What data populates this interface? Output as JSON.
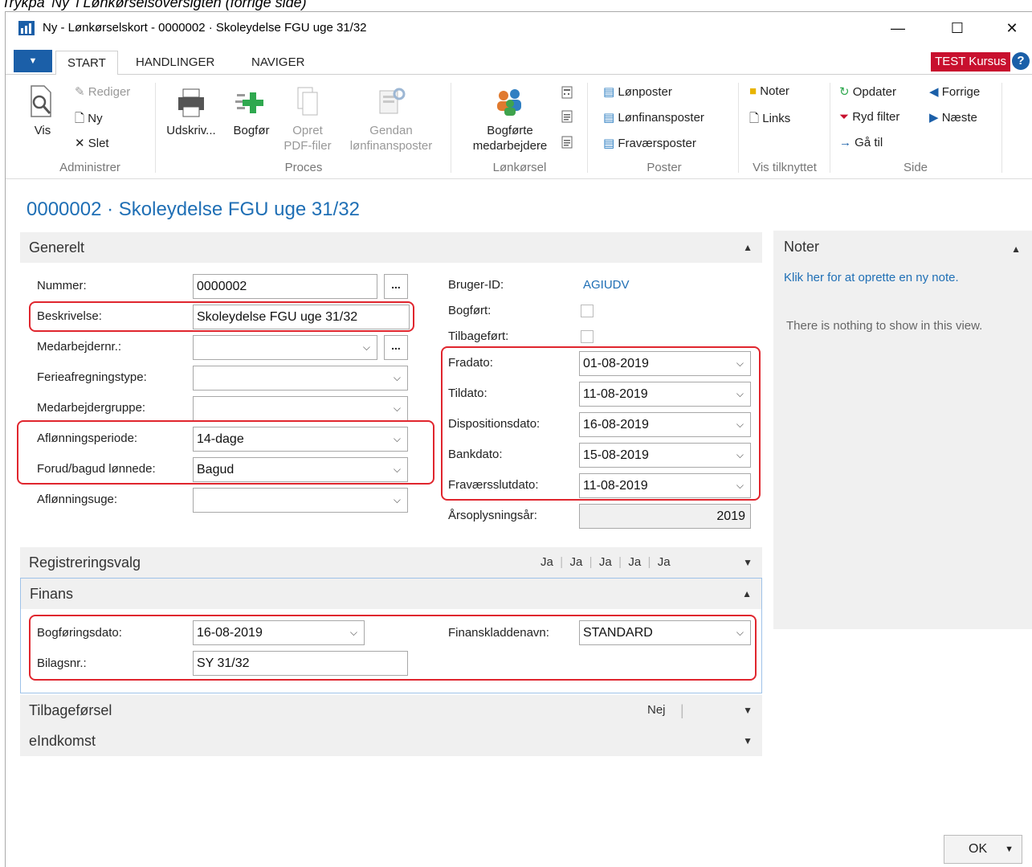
{
  "window": {
    "title": "Ny - Lønkørselskort - 0000002 · Skoleydelse FGU uge 31/32",
    "controls": {
      "minimize": "—",
      "maximize": "☐",
      "close": "✕"
    }
  },
  "tabs": [
    "START",
    "HANDLINGER",
    "NAVIGER"
  ],
  "badge": "TEST Kursus",
  "ribbon": {
    "administrer": {
      "label": "Administrer",
      "vis": "Vis",
      "rediger": "Rediger",
      "ny": "Ny",
      "slet": "Slet"
    },
    "proces": {
      "label": "Proces",
      "udskriv": "Udskriv...",
      "bogfor": "Bogfør",
      "opret_1": "Opret",
      "opret_2": "PDF-filer",
      "gendan_1": "Gendan",
      "gendan_2": "lønfinansposter"
    },
    "lonkorsel": {
      "label": "Lønkørsel",
      "bogforte_1": "Bogførte",
      "bogforte_2": "medarbejdere"
    },
    "poster": {
      "label": "Poster",
      "lonposter": "Lønposter",
      "lonfinansposter": "Lønfinansposter",
      "fravaersposter": "Fraværsposter"
    },
    "vis_tilknyttet": {
      "label": "Vis tilknyttet",
      "noter": "Noter",
      "links": "Links"
    },
    "side": {
      "label": "Side",
      "opdater": "Opdater",
      "ryd_filter": "Ryd filter",
      "ga_til": "Gå til",
      "forrige": "Forrige",
      "naeste": "Næste"
    }
  },
  "page_title": "0000002 · Skoleydelse FGU uge 31/32",
  "generelt": {
    "header": "Generelt",
    "nummer_label": "Nummer:",
    "nummer": "0000002",
    "beskrivelse_label": "Beskrivelse:",
    "beskrivelse": "Skoleydelse FGU uge 31/32",
    "medarbejdernr_label": "Medarbejdernr.:",
    "medarbejdernr": "",
    "ferieafregningstype_label": "Ferieafregningstype:",
    "ferieafregningstype": "",
    "medarbejdergruppe_label": "Medarbejdergruppe:",
    "medarbejdergruppe": "",
    "aflonningsperiode_label": "Aflønningsperiode:",
    "aflonningsperiode": "14-dage",
    "forud_bagud_label": "Forud/bagud lønnede:",
    "forud_bagud": "Bagud",
    "aflonningsuge_label": "Aflønningsuge:",
    "aflonningsuge": "",
    "bruger_id_label": "Bruger-ID:",
    "bruger_id": "AGIUDV",
    "bogfort_label": "Bogført:",
    "tilbagefort_label": "Tilbageført:",
    "fradato_label": "Fradato:",
    "fradato": "01-08-2019",
    "tildato_label": "Tildato:",
    "tildato": "11-08-2019",
    "dispositionsdato_label": "Dispositionsdato:",
    "dispositionsdato": "16-08-2019",
    "bankdato_label": "Bankdato:",
    "bankdato": "15-08-2019",
    "fravaersslutdato_label": "Fraværsslutdato:",
    "fravaersslutdato": "11-08-2019",
    "arsoplysningsar_label": "Årsoplysningsår:",
    "arsoplysningsar": "2019"
  },
  "registreringsvalg": {
    "header": "Registreringsvalg",
    "values": [
      "Ja",
      "Ja",
      "Ja",
      "Ja",
      "Ja"
    ]
  },
  "finans": {
    "header": "Finans",
    "bogforingsdato_label": "Bogføringsdato:",
    "bogforingsdato": "16-08-2019",
    "bilagsnr_label": "Bilagsnr.:",
    "bilagsnr": "SY 31/32",
    "finanskladdenavn_label": "Finanskladdenavn:",
    "finanskladdenavn": "STANDARD"
  },
  "tilbageforsel": {
    "header": "Tilbageførsel",
    "value": "Nej"
  },
  "eindkomst": {
    "header": "eIndkomst"
  },
  "noter_panel": {
    "header": "Noter",
    "link": "Klik her for at oprette en ny note.",
    "empty": "There is nothing to show in this view."
  },
  "ok_button": "OK",
  "top_note": "Trykpå 'Ny' i Lønkørselsoversigten (forrige side)"
}
